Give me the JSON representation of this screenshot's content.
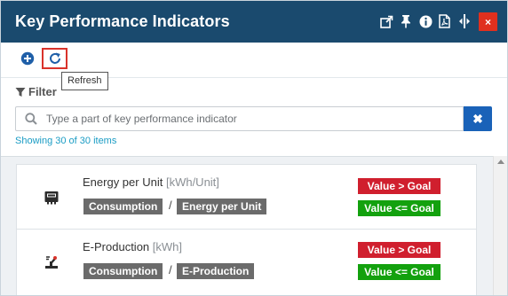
{
  "header": {
    "title": "Key Performance Indicators",
    "close_symbol": "×",
    "icons": [
      "popout-icon",
      "pin-icon",
      "info-icon",
      "pdf-icon",
      "resize-icon"
    ]
  },
  "toolbar": {
    "add_icon": "plus-circle-icon",
    "refresh_icon": "refresh-icon",
    "tooltip": "Refresh"
  },
  "filter": {
    "label": "Filter",
    "search_placeholder": "Type a part of key performance indicator",
    "clear_symbol": "✖",
    "count_text": "Showing 30 of 30 items"
  },
  "kpis": [
    {
      "name": "Energy per Unit",
      "unit": "[kWh/Unit]",
      "tag_left": "Consumption",
      "separator": "/",
      "tag_right": "Energy per Unit",
      "goal_above": "Value > Goal",
      "goal_below": "Value <= Goal"
    },
    {
      "name": "E-Production",
      "unit": "[kWh]",
      "tag_left": "Consumption",
      "separator": "/",
      "tag_right": "E-Production",
      "goal_above": "Value > Goal",
      "goal_below": "Value <= Goal"
    }
  ],
  "colors": {
    "header_bg": "#1a4a6e",
    "close_bg": "#e0301e",
    "search_button": "#1a62b8",
    "count_text": "#1a9cc4",
    "goal_red": "#d01f2e",
    "goal_green": "#13a10e",
    "tag_gray": "#6b6b6b"
  }
}
